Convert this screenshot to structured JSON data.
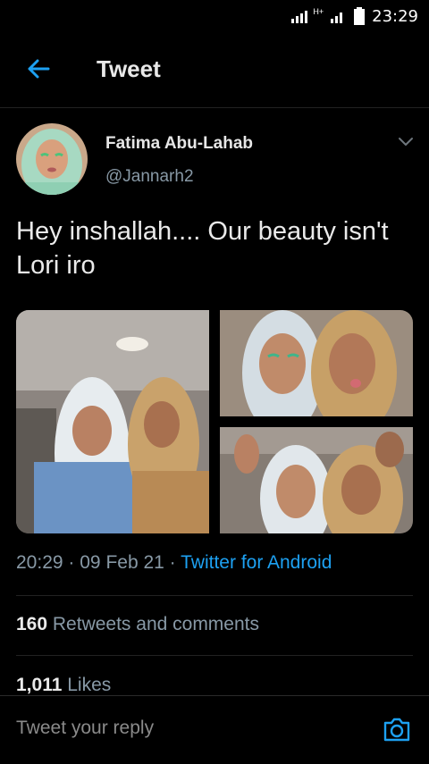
{
  "status_bar": {
    "time": "23:29",
    "network_label": "H+"
  },
  "header": {
    "title": "Tweet",
    "back_icon": "arrow-left-icon"
  },
  "tweet": {
    "author_name": "Fatima Abu-Lahab",
    "author_handle": "@Jannarh2",
    "text": "Hey inshallah.... Our beauty isn't Lori iro",
    "time": "20:29",
    "separator": "·",
    "date": "09 Feb 21",
    "source": "Twitter for Android",
    "retweets_count": "160",
    "retweets_label": "Retweets and comments",
    "likes_count": "1,011",
    "likes_label": "Likes"
  },
  "reply": {
    "placeholder": "Tweet your reply",
    "camera_icon": "camera-icon"
  },
  "colors": {
    "background": "#000000",
    "accent": "#1da1f2",
    "muted_text": "#8899a6"
  }
}
